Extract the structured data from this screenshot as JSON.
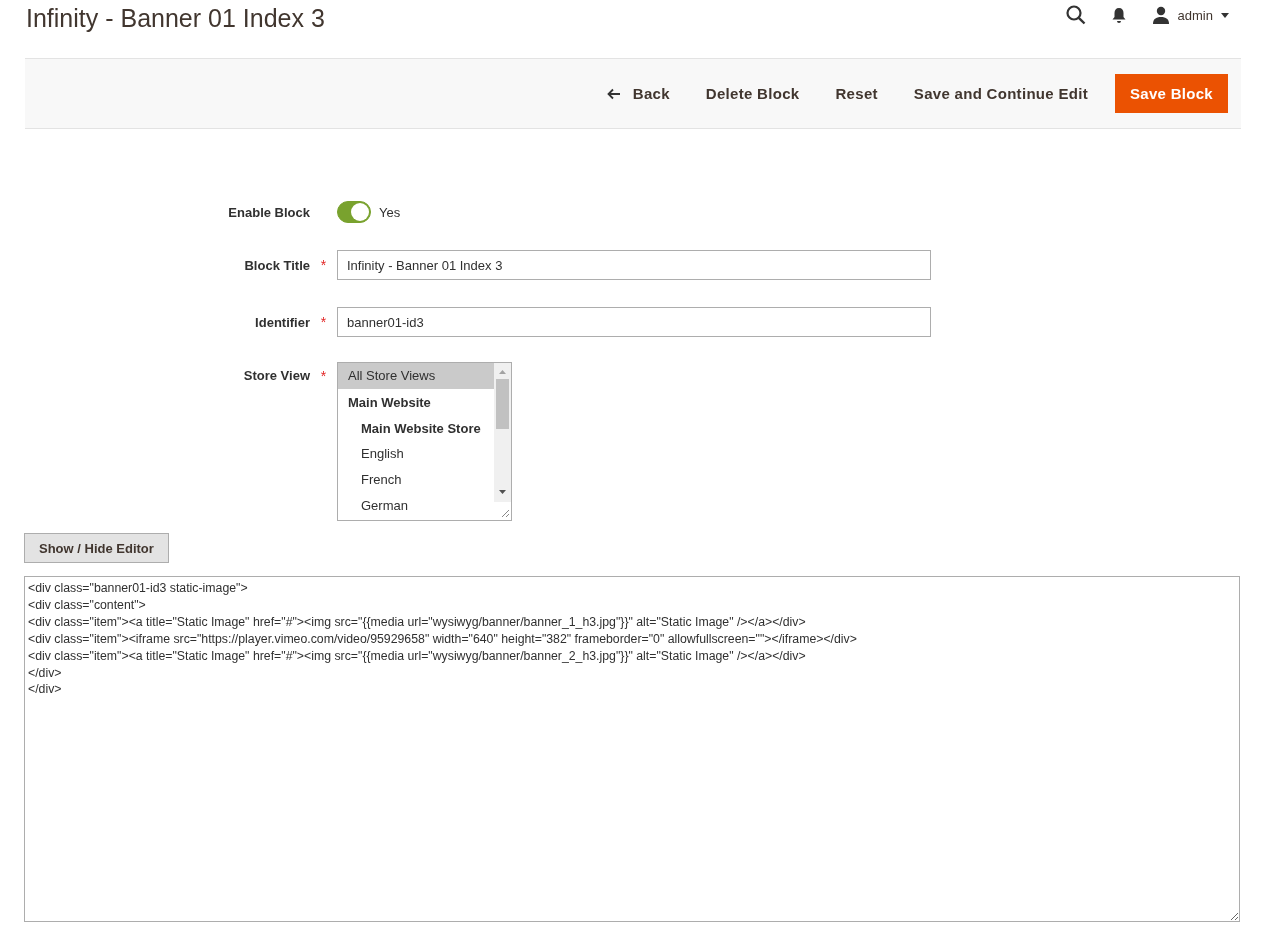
{
  "page_title": "Infinity - Banner 01 Index 3",
  "header": {
    "user": "admin"
  },
  "toolbar": {
    "buttons": [
      {
        "label": "Back",
        "kind": "back"
      },
      {
        "label": "Delete Block",
        "kind": "plain"
      },
      {
        "label": "Reset",
        "kind": "plain"
      },
      {
        "label": "Save and Continue Edit",
        "kind": "plain"
      },
      {
        "label": "Save Block",
        "kind": "primary"
      }
    ]
  },
  "form": {
    "enable_block": {
      "label": "Enable Block",
      "on": true,
      "value": "Yes"
    },
    "block_title": {
      "label": "Block Title",
      "required_mark": "*",
      "value": "Infinity - Banner 01 Index 3"
    },
    "identifier": {
      "label": "Identifier",
      "required_mark": "*",
      "value": "banner01-id3"
    },
    "store_view": {
      "label": "Store View",
      "required_mark": "*",
      "options": [
        {
          "label": "All Store Views",
          "selected": true
        },
        {
          "label": "Main Website",
          "selected": false,
          "children": [
            {
              "label": "Main Website Store",
              "selected": false,
              "children": [
                {
                  "label": "English",
                  "selected": false
                },
                {
                  "label": "French",
                  "selected": false
                },
                {
                  "label": "German",
                  "selected": false
                }
              ]
            }
          ]
        }
      ]
    }
  },
  "editor": {
    "toggle_button": "Show / Hide Editor",
    "lines": [
      "<div class=\"banner01-id3 static-image\">",
      "<div class=\"content\">",
      "<div class=\"item\"><a title=\"Static Image\" href=\"#\"><img src=\"{{media url=\"wysiwyg/banner/banner_1_h3.jpg\"}}\" alt=\"Static Image\" /></a></div>",
      "<div class=\"item\"><iframe src=\"https://player.vimeo.com/video/95929658\" width=\"640\" height=\"382\" frameborder=\"0\" allowfullscreen=\"\"></iframe></div>",
      "<div class=\"item\"><a title=\"Static Image\" href=\"#\"><img src=\"{{media url=\"wysiwyg/banner/banner_2_h3.jpg\"}}\" alt=\"Static Image\" /></a></div>",
      "</div>",
      "</div>"
    ]
  }
}
